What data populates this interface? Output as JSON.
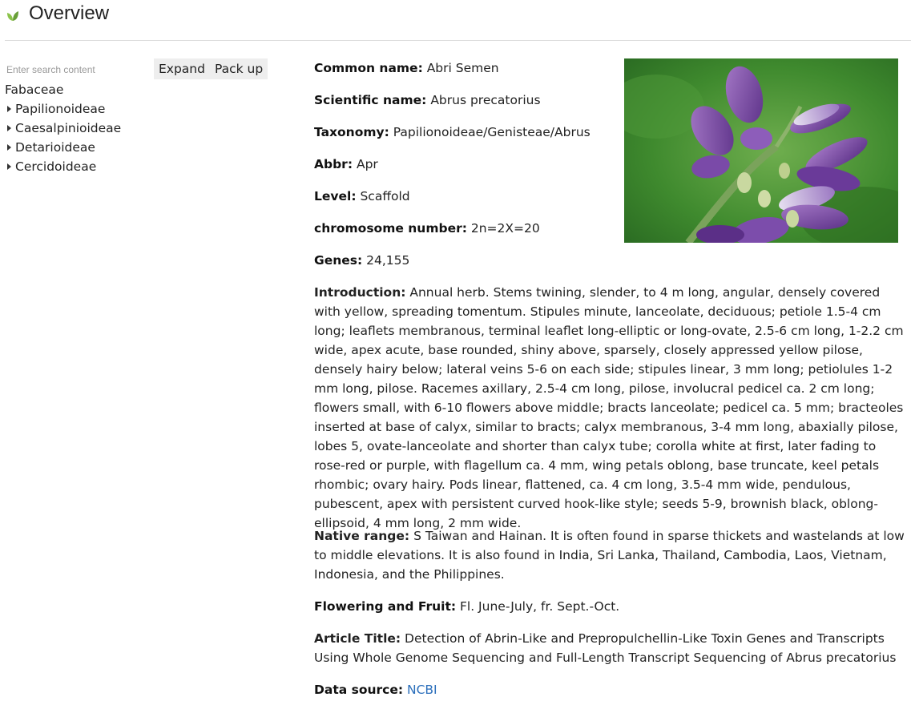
{
  "header": {
    "title": "Overview",
    "icon": "leaf-icon",
    "icon_color": "#7cb342"
  },
  "sidebar": {
    "search_placeholder": "Enter search content",
    "root": "Fabaceae",
    "items": [
      {
        "label": "Papilionoideae"
      },
      {
        "label": "Caesalpinioideae"
      },
      {
        "label": "Detarioideae"
      },
      {
        "label": "Cercidoideae"
      }
    ]
  },
  "toolbar": {
    "expand_label": "Expand",
    "packup_label": "Pack up"
  },
  "details": {
    "common_name_label": "Common name:",
    "common_name": "Abri Semen",
    "scientific_name_label": "Scientific name:",
    "scientific_name": "Abrus precatorius",
    "taxonomy_label": "Taxonomy:",
    "taxonomy": "Papilionoideae/Genisteae/Abrus",
    "abbr_label": "Abbr:",
    "abbr": "Apr",
    "level_label": "Level:",
    "level": "Scaffold",
    "chromosome_label": "chromosome number:",
    "chromosome": "2n=2X=20",
    "genes_label": "Genes:",
    "genes": "24,155",
    "introduction_label": "Introduction:",
    "introduction": "Annual herb. Stems twining, slender, to 4 m long, angular, densely covered with yellow, spreading tomentum. Stipules minute, lanceolate, deciduous; petiole 1.5-4 cm long; leaflets membranous, terminal leaflet long-elliptic or long-ovate, 2.5-6 cm long, 1-2.2 cm wide, apex acute, base rounded, shiny above, sparsely, closely appressed yellow pilose, densely hairy below; lateral veins 5-6 on each side; stipules linear, 3 mm long; petiolules 1-2 mm long, pilose. Racemes axillary, 2.5-4 cm long, pilose, involucral pedicel ca. 2 cm long; flowers small, with 6-10 flowers above middle; bracts lanceolate; pedicel ca. 5 mm; bracteoles inserted at base of calyx, similar to bracts; calyx membranous, 3-4 mm long, abaxially pilose, lobes 5, ovate-lanceolate and shorter than calyx tube; corolla white at first, later fading to rose-red or purple, with flagellum ca. 4 mm, wing petals oblong, base truncate, keel petals rhombic; ovary hairy. Pods linear, flattened, ca. 4 cm long, 3.5-4 mm wide, pendulous, pubescent, apex with persistent curved hook-like style; seeds 5-9, brownish black, oblong-ellipsoid, 4 mm long, 2 mm wide.",
    "native_range_label": "Native range:",
    "native_range": "S Taiwan and Hainan. It is often found in sparse thickets and wastelands at low to middle elevations. It is also found in India, Sri Lanka, Thailand, Cambodia, Laos, Vietnam, Indonesia, and the Philippines.",
    "flowering_label": "Flowering and Fruit:",
    "flowering": "Fl. June-July, fr. Sept.-Oct.",
    "article_title_label": "Article Title:",
    "article_title": "Detection of Abrin-Like and Prepropulchellin-Like Toxin Genes and Transcripts Using Whole Genome Sequencing and Full-Length Transcript Sequencing of Abrus precatorius",
    "data_source_label": "Data source:",
    "data_source": "NCBI"
  },
  "colors": {
    "link": "#2a6ebb",
    "divider": "#dcdcdc",
    "button_bg": "#eeeeee"
  }
}
